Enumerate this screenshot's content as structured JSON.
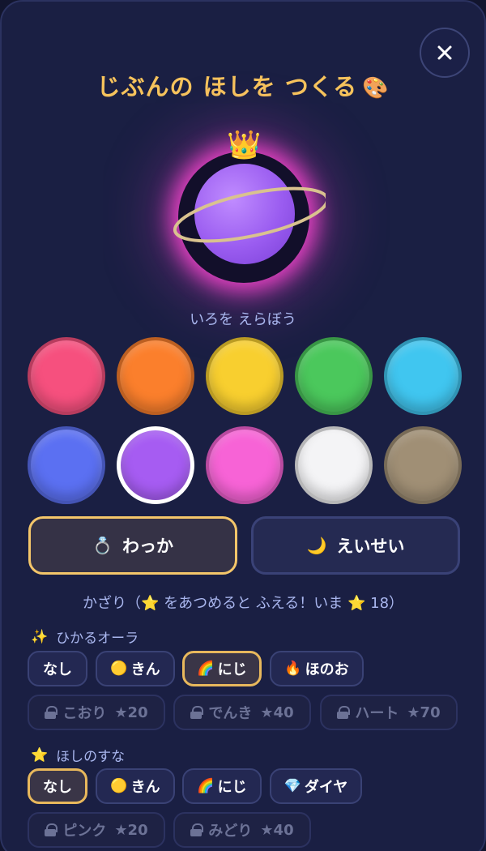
{
  "header": {
    "title": "じぶんの ほしを つくる",
    "title_icon": "palette-emoji",
    "close_icon": "close-icon"
  },
  "planet": {
    "color": "#9a5cf0",
    "glow": "#ff46d2",
    "accessory": "crown",
    "ring_color": "#d9c28f"
  },
  "colors": {
    "label": "いろを えらぼう",
    "swatches": [
      {
        "name": "red-pink",
        "hex": "#f6507e"
      },
      {
        "name": "orange",
        "hex": "#fb7f2c"
      },
      {
        "name": "yellow",
        "hex": "#f8cf2f"
      },
      {
        "name": "green",
        "hex": "#4bc85c"
      },
      {
        "name": "sky",
        "hex": "#40c6f0"
      },
      {
        "name": "blue",
        "hex": "#5b70f2"
      },
      {
        "name": "purple",
        "hex": "#a65cf2",
        "selected": true
      },
      {
        "name": "pink",
        "hex": "#f763d6"
      },
      {
        "name": "white",
        "hex": "#f4f4f6"
      },
      {
        "name": "taupe",
        "hex": "#a08f75"
      }
    ]
  },
  "mode": {
    "ring_label": "わっか",
    "ring_icon": "💍",
    "moon_label": "えいせい",
    "moon_icon": "🌙",
    "selected": "ring"
  },
  "deco_note": "かざり（⭐ をあつめると ふえる！いま ⭐ 18）",
  "aura": {
    "icon": "✨",
    "heading": "ひかるオーラ",
    "options": [
      {
        "label": "なし"
      },
      {
        "label": "きん",
        "icon": "🟡"
      },
      {
        "label": "にじ",
        "icon": "🌈",
        "selected": true
      },
      {
        "label": "ほのお",
        "icon": "🔥"
      }
    ],
    "locked": [
      {
        "label": "こおり",
        "cost": "★20"
      },
      {
        "label": "でんき",
        "cost": "★40"
      },
      {
        "label": "ハート",
        "cost": "★70"
      }
    ]
  },
  "stardust": {
    "icon": "⭐",
    "heading": "ほしのすな",
    "options": [
      {
        "label": "なし",
        "selected": true
      },
      {
        "label": "きん",
        "icon": "🟡"
      },
      {
        "label": "にじ",
        "icon": "🌈"
      },
      {
        "label": "ダイヤ",
        "icon": "💎"
      }
    ],
    "locked": [
      {
        "label": "ピンク",
        "cost": "★20"
      },
      {
        "label": "みどり",
        "cost": "★40"
      }
    ]
  }
}
